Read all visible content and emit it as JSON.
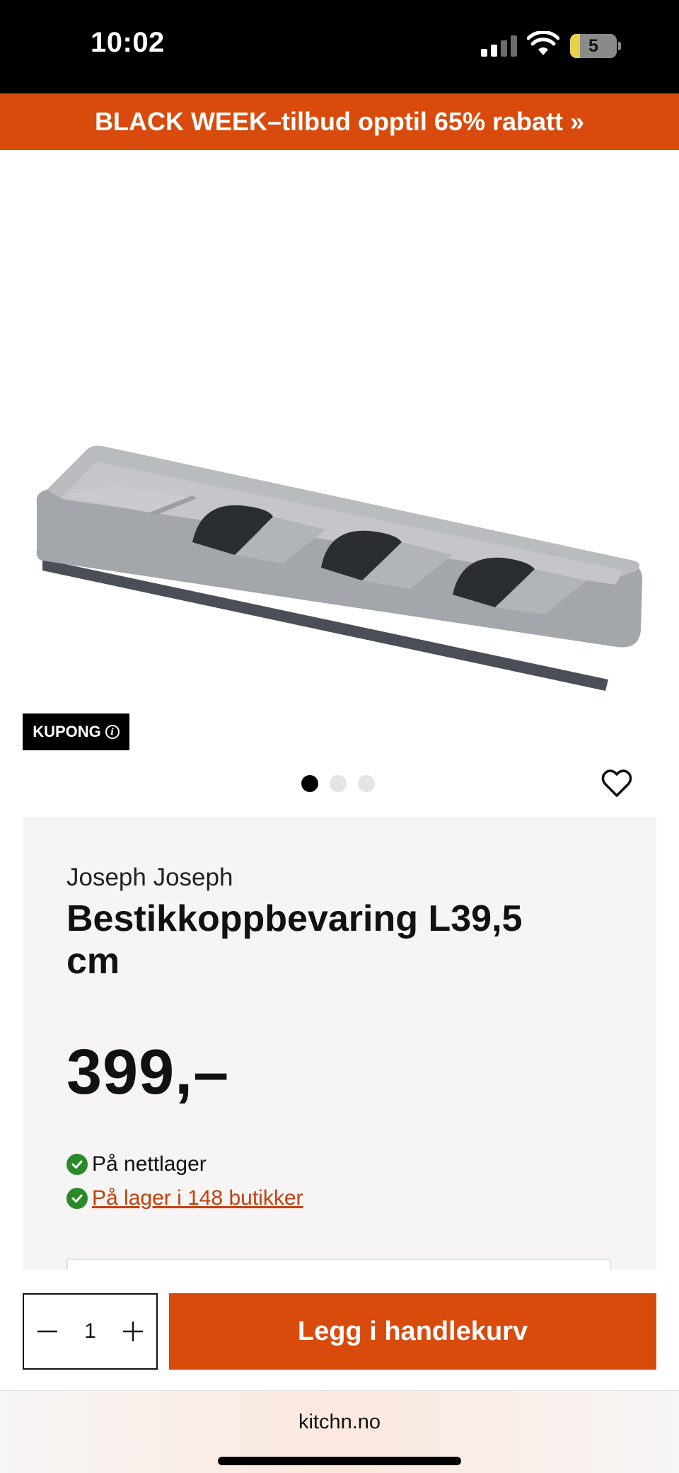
{
  "status_bar": {
    "time": "10:02",
    "battery": "5"
  },
  "promo": {
    "text": "BLACK WEEK–tilbud opptil 65% rabatt »"
  },
  "product": {
    "coupon_label": "KUPONG",
    "coupon_info_glyph": "i",
    "gallery": {
      "count": 3,
      "active_index": 0
    },
    "brand": "Joseph Joseph",
    "title": "Bestikkoppbevaring L39,5 cm",
    "price": "399,–",
    "stock_online": "På nettlager",
    "stock_stores": "På lager i 148 butikker"
  },
  "cart": {
    "quantity": "1",
    "add_label": "Legg i handlekurv"
  },
  "browser": {
    "url": "kitchn.no"
  },
  "colors": {
    "accent": "#d94a0d",
    "link": "#c2410c",
    "in_stock": "#2a8a2a",
    "card_bg": "#f6f4f4"
  },
  "icons": [
    "signal-icon",
    "wifi-icon",
    "battery-icon",
    "info-icon",
    "heart-icon",
    "check-icon",
    "minus-icon",
    "plus-icon"
  ]
}
